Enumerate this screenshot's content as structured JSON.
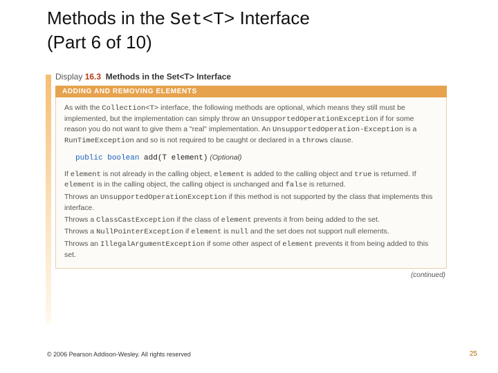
{
  "title": {
    "prefix": "Methods in the ",
    "code": "Set<T>",
    "suffix": " Interface",
    "sub": "(Part 6 of 10)"
  },
  "display": {
    "label": "Display ",
    "number": "16.3",
    "caption": "Methods in the Set<T> Interface"
  },
  "section_heading": "ADDING AND REMOVING ELEMENTS",
  "intro": {
    "t1": "As with the ",
    "c1": "Collection<T>",
    "t2": " interface, the following methods are optional, which means they still must be implemented, but the implementation can simply throw an ",
    "c2": "UnsupportedOperationException",
    "t3": " if for some reason you do not want to give them a \"real\" implementation. An ",
    "c3": "UnsupportedOperation-Exception",
    "t4": " is a ",
    "c4": "RunTimeException",
    "t5": " and so is not required to be caught or declared in a ",
    "c5": "throws",
    "t6": " clause."
  },
  "method": {
    "kw_public": "public",
    "kw_boolean": "boolean",
    "name_and_params": " add(T element)",
    "optional": " (Optional)"
  },
  "desc": {
    "p1a": "If ",
    "c1": "element",
    "p1b": " is not already in the calling object, ",
    "c2": "element",
    "p1c": " is added to the calling object and ",
    "c3": "true",
    "p1d": " is returned. If ",
    "c4": "element",
    "p1e": " is in the calling object, the calling object is unchanged and ",
    "c5": "false",
    "p1f": " is returned.",
    "p2a": "Throws an ",
    "c6": "UnsupportedOperationException",
    "p2b": " if this method is not supported by the class that implements this interface.",
    "p3a": "Throws a ",
    "c7": "ClassCastException",
    "p3b": " if the class of ",
    "c8": "element",
    "p3c": " prevents it from being added to the set.",
    "p4a": "Throws a ",
    "c9": "NullPointerException",
    "p4b": " if ",
    "c10": "element",
    "p4c": " is ",
    "c11": "null",
    "p4d": " and the set does not support null elements.",
    "p5a": "Throws an ",
    "c12": "IllegalArgumentException",
    "p5b": " if some other aspect of ",
    "c13": "element",
    "p5c": " prevents it from being added to this set."
  },
  "continued": "(continued)",
  "footer": {
    "copyright": "© 2006 Pearson Addison-Wesley. All rights reserved",
    "pagenum": "25"
  }
}
